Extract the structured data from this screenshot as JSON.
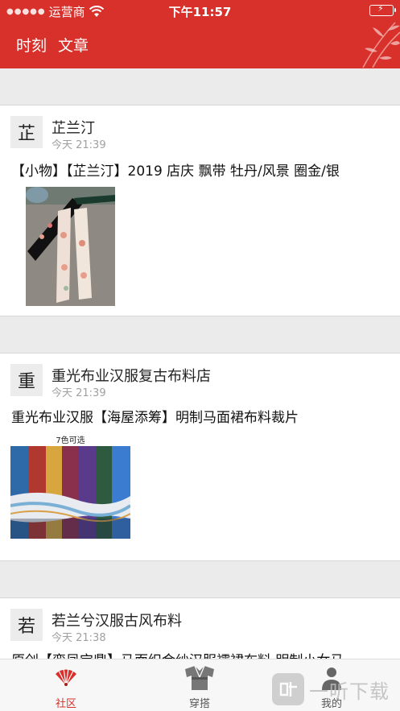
{
  "status": {
    "carrier": "运营商",
    "time": "下午11:57"
  },
  "nav": {
    "tabs": [
      "时刻",
      "文章"
    ]
  },
  "posts": [
    {
      "avatar": "芷",
      "shop": "芷兰汀",
      "time": "今天 21:39",
      "title": "【小物】【芷兰汀】2019 店庆 飘带 牡丹/风景 圈金/银"
    },
    {
      "avatar": "重",
      "shop": "重光布业汉服复古布料店",
      "time": "今天 21:39",
      "title": "重光布业汉服【海屋添筹】明制马面裙布料裁片",
      "image_caption": "7色可选"
    },
    {
      "avatar": "若",
      "shop": "若兰兮汉服古风布料",
      "time": "今天 21:38",
      "title": "原创【鸾凤宝鼎】马面织金纱汉服襦裙布料 明制小女马"
    }
  ],
  "tabbar": [
    {
      "label": "社区",
      "icon": "fan-icon",
      "active": true
    },
    {
      "label": "穿搭",
      "icon": "hanfu-icon",
      "active": false
    },
    {
      "label": "我的",
      "icon": "user-icon",
      "active": false
    }
  ],
  "watermark": "一听下载",
  "colors": {
    "brand": "#d8302a",
    "tab_active": "#d8302a",
    "tab_inactive": "#555555"
  }
}
